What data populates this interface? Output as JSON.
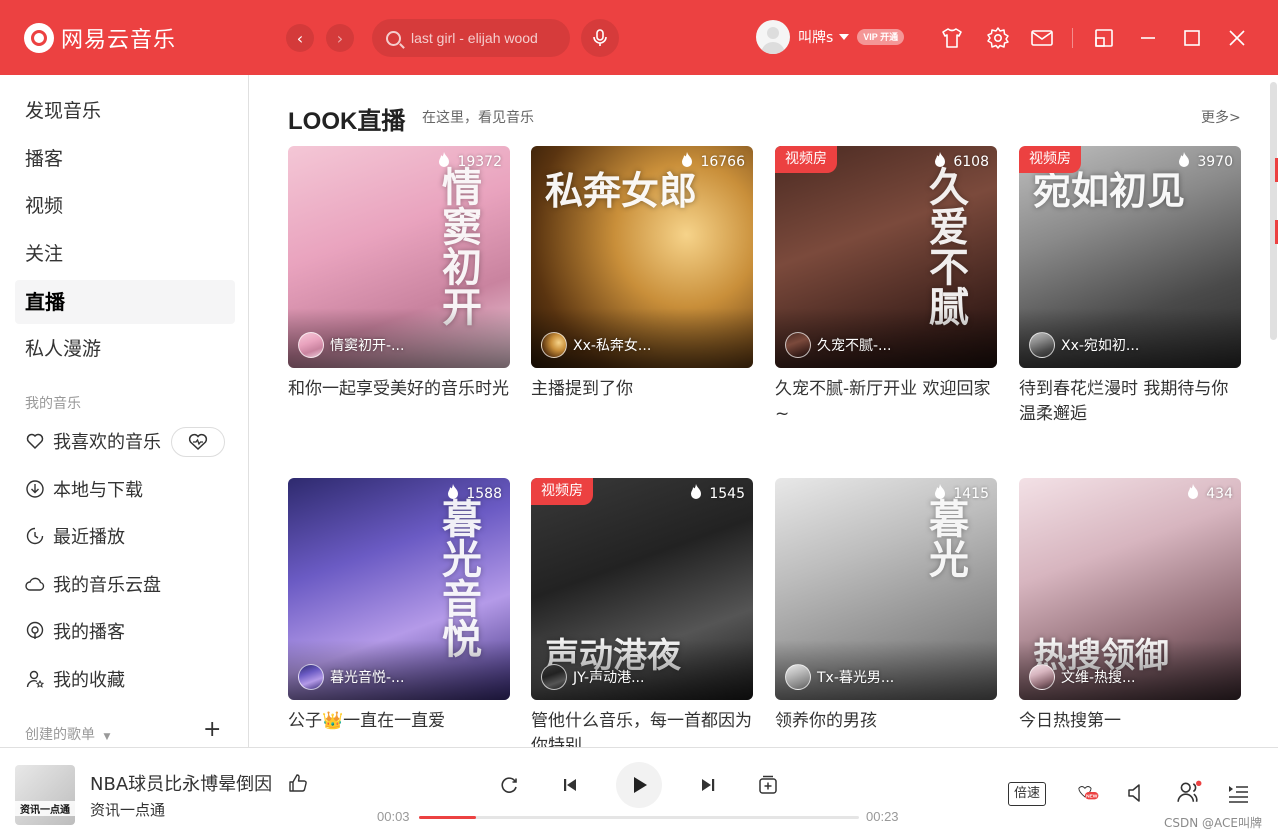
{
  "app": {
    "name": "网易云音乐"
  },
  "search": {
    "placeholder": "last girl - elijah wood"
  },
  "user": {
    "name": "叫牌s",
    "vip_badge": "VIP 开通"
  },
  "sidebar": {
    "nav": [
      "发现音乐",
      "播客",
      "视频",
      "关注",
      "直播",
      "私人漫游"
    ],
    "active": "直播",
    "my_music_label": "我的音乐",
    "my_music": [
      "我喜欢的音乐",
      "本地与下载",
      "最近播放",
      "我的音乐云盘",
      "我的播客",
      "我的收藏"
    ],
    "created_label": "创建的歌单"
  },
  "main": {
    "title": "LOOK直播",
    "subtitle": "在这里，看见音乐",
    "more": "更多>",
    "cards": [
      {
        "count": "19372",
        "tag": "",
        "host": "情窦初开-...",
        "title": "和你一起享受美好的音乐时光",
        "art": "情窦初开",
        "bg": "linear-gradient(160deg,#f4c7d6 0%,#e9a3be 40%,#c9839f 70%,#f2d3e0 100%)"
      },
      {
        "count": "16766",
        "tag": "",
        "host": "Xx-私奔女...",
        "title": "主播提到了你",
        "art": "私奔女郎",
        "bg": "radial-gradient(circle at 70% 40%,#f6d38a 0%,#c98f3a 35%,#5a3410 75%,#2b1806 100%)"
      },
      {
        "count": "6108",
        "tag": "视频房",
        "host": "久宠不腻-...",
        "title": "久宠不腻-新厅开业 欢迎回家~",
        "art": "久爱不腻",
        "bg": "linear-gradient(160deg,#4a2a22 0%,#7b4a3c 40%,#3a1f1a 80%,#1e0f0c 100%)"
      },
      {
        "count": "3970",
        "tag": "视频房",
        "host": "Xx-宛如初...",
        "title": "待到春花烂漫时 我期待与你温柔邂逅",
        "art": "宛如初见",
        "bg": "linear-gradient(160deg,#bfbfbf 0%,#8a8a8a 35%,#4a4a4a 70%,#2a2a2a 100%)"
      },
      {
        "count": "1588",
        "tag": "",
        "host": "暮光音悦-...",
        "title": "公子👑一直在一直爱",
        "art": "暮光音悦",
        "bg": "linear-gradient(160deg,#2e2a6e 0%,#6b5bc4 35%,#b49ae8 65%,#3a2d7a 100%)"
      },
      {
        "count": "1545",
        "tag": "视频房",
        "host": "JY-声动港...",
        "title": "管他什么音乐，每一首都因为你特别",
        "art": "声动港夜",
        "bg": "linear-gradient(160deg,#3a3a3a 0%,#222 40%,#555 70%,#1a1a1a 100%)"
      },
      {
        "count": "1415",
        "tag": "",
        "host": "Tx-暮光男...",
        "title": "领养你的男孩",
        "art": "暮光",
        "bg": "linear-gradient(160deg,#e8e8e8 0%,#bdbdbd 35%,#8d8d8d 70%,#5e5e5e 100%)"
      },
      {
        "count": "434",
        "tag": "",
        "host": "文维-热搜...",
        "title": "今日热搜第一",
        "art": "热搜领御",
        "bg": "linear-gradient(160deg,#f3e1e6 0%,#d7b5bf 35%,#8f6b74 70%,#3c2a30 100%)"
      }
    ]
  },
  "player": {
    "cover_text": "资讯一点通",
    "title": "NBA球员比永博晕倒因",
    "artist": "资讯一点通",
    "elapsed": "00:03",
    "duration": "00:23",
    "progress": 0.13,
    "speed": "倍速",
    "new_badge": "NEW"
  },
  "watermark": "CSDN @ACE叫牌",
  "colors": {
    "accent": "#ec4141"
  }
}
